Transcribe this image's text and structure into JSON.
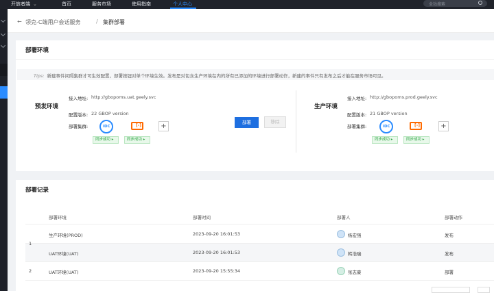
{
  "topnav": {
    "dev_label": "开放者端",
    "items": [
      "首页",
      "服务市场",
      "使用指南",
      "个人中心"
    ],
    "active_index": 3,
    "search_placeholder": "全站搜索"
  },
  "breadcrumb": {
    "back": "←",
    "root": "领克-C端用户会话服务",
    "sep": "/",
    "current": "集群部署"
  },
  "deploy_env": {
    "title": "部署环境",
    "tips_label": "Tips:",
    "tips_text": "新建事件间隔集群才可生效配置，部署按钮对单个环境生效。发布是对包含生产环境在内的所有已添加的环境进行部署动作，新建的事件只有发布之后才能在服务市场可见。",
    "envs": [
      {
        "name": "预发环境",
        "access_label": "接入地址:",
        "access_value": "http://gbopoms.uat.geely.svc",
        "version_label": "配置版本:",
        "version_value": "22 GBOP version",
        "cluster_label": "部署集群:",
        "clusters": [
          {
            "icon": "idc-cluster-icon",
            "text": "IDC",
            "status": "同步成功 ▸"
          },
          {
            "icon": "aliyun-cluster-icon",
            "text": "[-]",
            "status": "同步成功 ▸"
          }
        ],
        "add": "+"
      },
      {
        "name": "生产环境",
        "access_label": "接入地址:",
        "access_value": "http://gbopoms.prod.geely.svc",
        "version_label": "配置版本:",
        "version_value": "21 GBOP version",
        "cluster_label": "部署集群:",
        "clusters": [
          {
            "icon": "idc-cluster-icon",
            "text": "IDC",
            "status": "同步成功 ▸"
          },
          {
            "icon": "aliyun-cluster-icon",
            "text": "[-]",
            "status": "同步成功 ▸"
          }
        ],
        "add": "+"
      }
    ],
    "deploy_button": "部署",
    "remove_button": "移除"
  },
  "records": {
    "title": "部署记录",
    "columns": [
      "部署环境",
      "部署时间",
      "部署人",
      "部署动作"
    ],
    "groups": [
      {
        "num": "1",
        "rows": [
          {
            "env": "生产环境(PROD)",
            "time": "2023-09-20 16:01:53",
            "user": "杨宏强",
            "action": "发布"
          },
          {
            "env": "UAT环境(UAT)",
            "time": "2023-09-20 16:01:53",
            "user": "韩浩瑞",
            "action": "发布"
          }
        ]
      },
      {
        "num": "2",
        "rows": [
          {
            "env": "UAT环境(UAT)",
            "time": "2023-09-20 15:55:34",
            "user": "张志豪",
            "action": "部署"
          }
        ]
      }
    ]
  },
  "colors": {
    "accent": "#1e6fe0",
    "nav_bg": "#20232b",
    "success": "#29a340",
    "aliyun": "#ff6a00"
  }
}
